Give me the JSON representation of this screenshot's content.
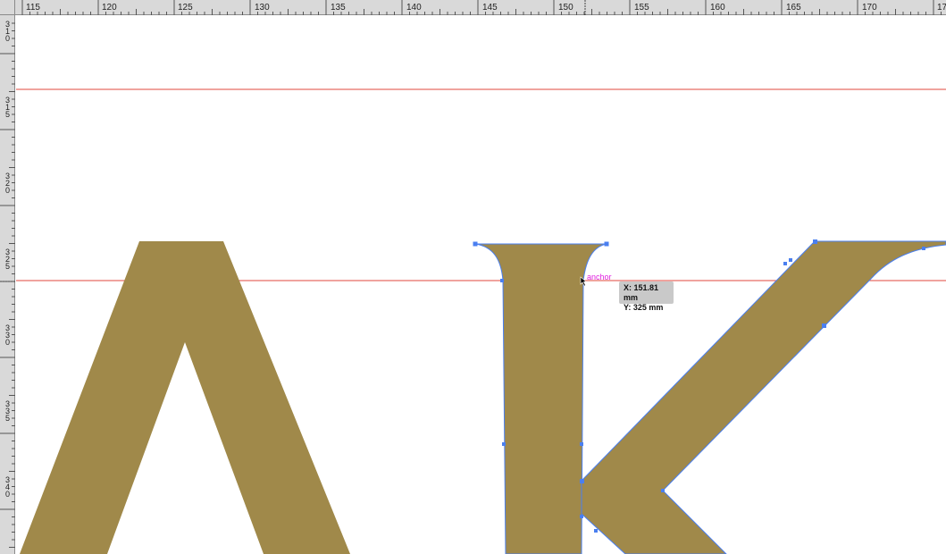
{
  "rulers": {
    "unit": "mm",
    "horizontal_labels": [
      "115",
      "120",
      "125",
      "130",
      "135",
      "140",
      "145",
      "150",
      "155",
      "160",
      "165",
      "170",
      "17"
    ],
    "vertical_labels": [
      "310",
      "315",
      "320",
      "325",
      "330",
      "335",
      "340"
    ]
  },
  "colors": {
    "fill": "#a0894a",
    "guide": "#e0473c",
    "selection": "#4a7ff0",
    "anchor_label": "#e022e0",
    "tooltip_bg": "#c9c9c9",
    "ruler_bg": "#d9d9d9"
  },
  "smart_guide": {
    "label": "anchor"
  },
  "tooltip": {
    "x": "X: 151.81 mm",
    "y": "Y: 325 mm"
  },
  "cursor": {
    "icon": "direct-selection-arrow-icon"
  }
}
